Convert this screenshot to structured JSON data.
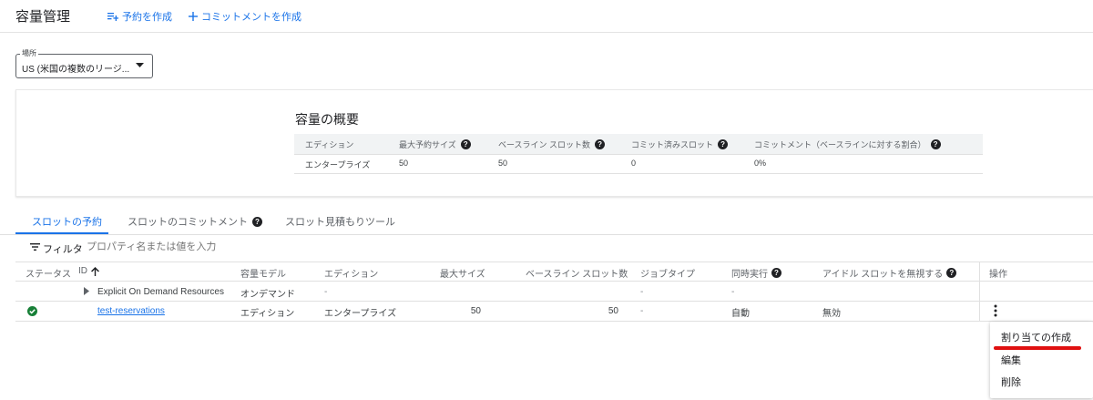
{
  "header": {
    "title": "容量管理",
    "create_reservation": "予約を作成",
    "create_commitment": "コミットメントを作成"
  },
  "location": {
    "legend": "場所",
    "value": "US (米国の複数のリージ..."
  },
  "summary": {
    "title": "容量の概要",
    "headers": [
      "エディション",
      "最大予約サイズ",
      "ベースライン スロット数",
      "コミット済みスロット",
      "コミットメント（ベースラインに対する割合）"
    ],
    "values": [
      "エンタープライズ",
      "50",
      "50",
      "0",
      "0%"
    ]
  },
  "tabs": {
    "reservations": "スロットの予約",
    "commitments": "スロットのコミットメント",
    "estimator": "スロット見積もりツール"
  },
  "filter": {
    "label": "フィルタ",
    "placeholder": "プロパティ名または値を入力"
  },
  "table": {
    "headers": {
      "status": "ステータス",
      "id": "ID",
      "model": "容量モデル",
      "edition": "エディション",
      "max_size": "最大サイズ",
      "baseline": "ベースライン スロット数",
      "job_type": "ジョブタイプ",
      "concurrency": "同時実行",
      "ignore_idle": "アイドル スロットを無視する",
      "actions": "操作"
    },
    "rows": [
      {
        "id": "Explicit On Demand Resources",
        "model": "オンデマンド",
        "edition": "-",
        "max_size": "",
        "baseline": "",
        "job_type": "-",
        "concurrency": "-",
        "ignore_idle": ""
      },
      {
        "id": "test-reservations",
        "model": "エディション",
        "edition": "エンタープライズ",
        "max_size": "50",
        "baseline": "50",
        "job_type": "-",
        "concurrency": "自動",
        "ignore_idle": "無効"
      }
    ]
  },
  "menu": {
    "items": [
      "割り当ての作成",
      "編集",
      "削除"
    ]
  },
  "colors": {
    "accent": "#1a73e8",
    "success": "#188038",
    "annotation": "#e01010"
  }
}
